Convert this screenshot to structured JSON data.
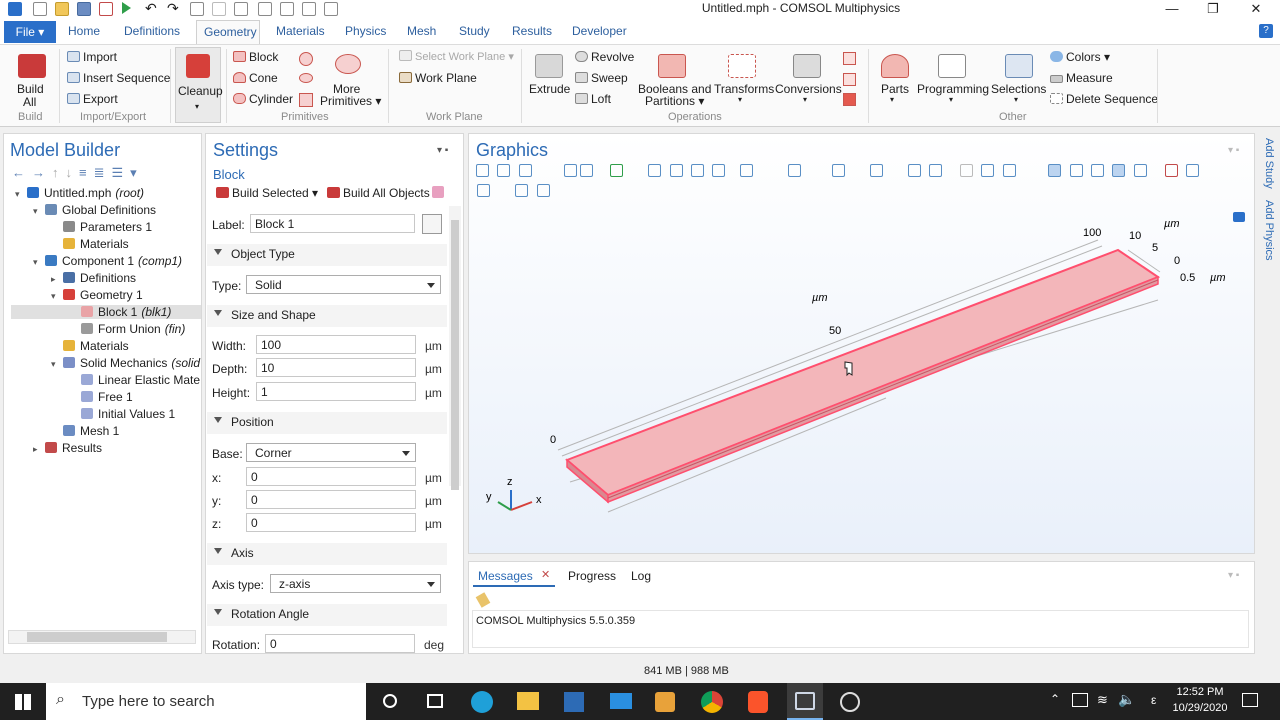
{
  "window": {
    "title": "Untitled.mph - COMSOL Multiphysics",
    "minimize": "—",
    "restore": "❐",
    "close": "✕"
  },
  "ribbon_tabs": {
    "file": "File ▾",
    "tabs": [
      "Home",
      "Definitions",
      "Geometry",
      "Materials",
      "Physics",
      "Mesh",
      "Study",
      "Results",
      "Developer"
    ],
    "active": "Geometry",
    "help": "?"
  },
  "ribbon": {
    "build_all": [
      "Build",
      "All"
    ],
    "import": "Import",
    "insert_sequence": "Insert Sequence",
    "export": "Export",
    "cleanup": "Cleanup",
    "block": "Block",
    "cone": "Cone",
    "cylinder": "Cylinder",
    "more_primitives": [
      "More",
      "Primitives ▾"
    ],
    "select_work_plane": "Select Work Plane ▾",
    "work_plane": "Work Plane",
    "extrude": "Extrude",
    "revolve": "Revolve",
    "sweep": "Sweep",
    "loft": "Loft",
    "booleans": [
      "Booleans and",
      "Partitions ▾"
    ],
    "transforms": "Transforms",
    "conversions": "Conversions",
    "parts": "Parts",
    "programming": "Programming",
    "selections": "Selections",
    "colors": "Colors ▾",
    "measure": "Measure",
    "delete_sequence": "Delete Sequence",
    "groups": {
      "build": "Build",
      "import_export": "Import/Export",
      "primitives": "Primitives",
      "work_plane": "Work Plane",
      "operations": "Operations",
      "other": "Other"
    }
  },
  "model_builder": {
    "title": "Model Builder",
    "tree": [
      {
        "label": "Untitled.mph",
        "tag": "(root)",
        "icon": "root-icon",
        "indent": 0,
        "arrow": "▾"
      },
      {
        "label": "Global Definitions",
        "tag": "",
        "icon": "global-definitions-icon",
        "indent": 1,
        "arrow": "▾"
      },
      {
        "label": "Parameters 1",
        "tag": "",
        "icon": "parameters-icon",
        "indent": 2,
        "arrow": ""
      },
      {
        "label": "Materials",
        "tag": "",
        "icon": "materials-icon",
        "indent": 2,
        "arrow": ""
      },
      {
        "label": "Component 1",
        "tag": "(comp1)",
        "icon": "component-icon",
        "indent": 1,
        "arrow": "▾"
      },
      {
        "label": "Definitions",
        "tag": "",
        "icon": "definitions-icon",
        "indent": 2,
        "arrow": "▸"
      },
      {
        "label": "Geometry 1",
        "tag": "",
        "icon": "geometry-icon",
        "indent": 2,
        "arrow": "▾"
      },
      {
        "label": "Block 1",
        "tag": "(blk1)",
        "icon": "block-icon",
        "indent": 3,
        "arrow": "",
        "selected": true
      },
      {
        "label": "Form Union",
        "tag": "(fin)",
        "icon": "form-union-icon",
        "indent": 3,
        "arrow": ""
      },
      {
        "label": "Materials",
        "tag": "",
        "icon": "materials-icon",
        "indent": 2,
        "arrow": ""
      },
      {
        "label": "Solid Mechanics",
        "tag": "(solid",
        "icon": "solid-mechanics-icon",
        "indent": 2,
        "arrow": "▾"
      },
      {
        "label": "Linear Elastic Mate",
        "tag": "",
        "icon": "linear-elastic-icon",
        "indent": 3,
        "arrow": ""
      },
      {
        "label": "Free 1",
        "tag": "",
        "icon": "free-icon",
        "indent": 3,
        "arrow": ""
      },
      {
        "label": "Initial Values 1",
        "tag": "",
        "icon": "initial-values-icon",
        "indent": 3,
        "arrow": ""
      },
      {
        "label": "Mesh 1",
        "tag": "",
        "icon": "mesh-icon",
        "indent": 2,
        "arrow": ""
      },
      {
        "label": "Results",
        "tag": "",
        "icon": "results-icon",
        "indent": 1,
        "arrow": "▸"
      }
    ]
  },
  "settings": {
    "title": "Settings",
    "subtitle": "Block",
    "build_selected": "Build Selected",
    "build_all_objects": "Build All Objects",
    "label_caption": "Label:",
    "label_value": "Block 1",
    "object_type": {
      "section": "Object Type",
      "type_caption": "Type:",
      "type_value": "Solid"
    },
    "size_shape": {
      "section": "Size and Shape",
      "width_caption": "Width:",
      "width": "100",
      "depth_caption": "Depth:",
      "depth": "10",
      "height_caption": "Height:",
      "height": "1",
      "unit": "µm"
    },
    "position": {
      "section": "Position",
      "base_caption": "Base:",
      "base": "Corner",
      "x_caption": "x:",
      "x": "0",
      "y_caption": "y:",
      "y": "0",
      "z_caption": "z:",
      "z": "0",
      "unit": "µm"
    },
    "axis": {
      "section": "Axis",
      "axis_type_caption": "Axis type:",
      "axis_type": "z-axis"
    },
    "rotation": {
      "section": "Rotation Angle",
      "rotation_caption": "Rotation:",
      "rotation": "0",
      "unit": "deg"
    }
  },
  "graphics": {
    "title": "Graphics",
    "axis_labels": {
      "y100": "100",
      "y50": "50",
      "y0": "0",
      "x10": "10",
      "x5": "5",
      "z0": "0",
      "z05": "0.5",
      "unit_top": "µm",
      "unit_right": "µm",
      "unit_mid": "µm"
    },
    "triad": {
      "x": "x",
      "y": "y",
      "z": "z"
    },
    "side_tabs": [
      "Add Study",
      "Add Physics"
    ],
    "colors": {
      "block_fill": "#e8a9ae",
      "block_edge": "#d46c78",
      "highlight": "#ff4f6e"
    }
  },
  "messages": {
    "tabs": [
      "Messages",
      "Progress",
      "Log"
    ],
    "active": "Messages",
    "text": "COMSOL Multiphysics 5.5.0.359"
  },
  "status_bar": {
    "memory": "841 MB | 988 MB"
  },
  "taskbar": {
    "search_placeholder": "Type here to search",
    "time": "12:52 PM",
    "date": "10/29/2020",
    "lang": "ε"
  }
}
